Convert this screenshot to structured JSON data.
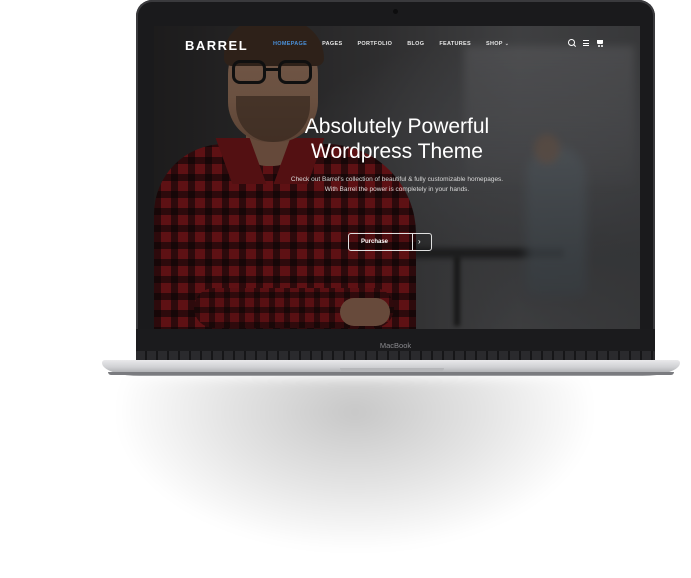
{
  "device": {
    "label": "MacBook"
  },
  "nav": {
    "logo": "BARREL",
    "items": [
      {
        "label": "HOMEPAGE",
        "active": true
      },
      {
        "label": "PAGES",
        "active": false
      },
      {
        "label": "PORTFOLIO",
        "active": false
      },
      {
        "label": "BLOG",
        "active": false
      },
      {
        "label": "FEATURES",
        "active": false
      },
      {
        "label": "SHOP",
        "active": false
      }
    ],
    "shop_caret": "⌄",
    "icons": [
      "search-icon",
      "menu-icon",
      "cart-icon"
    ]
  },
  "hero": {
    "title_line1": "Absolutely Powerful",
    "title_line2": "Wordpress Theme",
    "subtitle_line1": "Check out Barrel's collection of beautiful & fully customizable homepages.",
    "subtitle_line2": "With Barrel the power is completely in your hands.",
    "button_label": "Purchase",
    "button_arrow": "›"
  },
  "colors": {
    "accent": "#4a90d9",
    "shirt_red": "#a3171c",
    "bezel": "#1a1a1c"
  }
}
